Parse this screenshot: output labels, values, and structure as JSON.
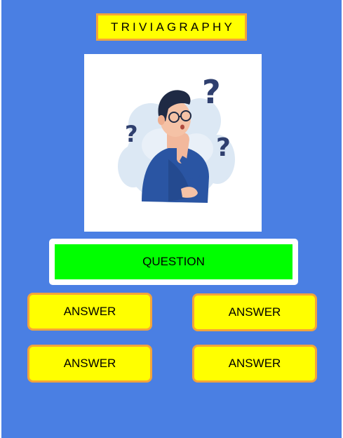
{
  "app": {
    "title": "TRIVIAGRAPHY"
  },
  "illustration": {
    "subject": "thinking-person-with-question-marks"
  },
  "question": {
    "text": "QUESTION"
  },
  "answers": [
    {
      "label": "ANSWER"
    },
    {
      "label": "ANSWER"
    },
    {
      "label": "ANSWER"
    },
    {
      "label": "ANSWER"
    }
  ],
  "colors": {
    "background": "#4a7fe3",
    "title_fill": "#ffff00",
    "button_border": "#f4a33a",
    "question_fill": "#00ff00",
    "answer_fill": "#ffff00"
  }
}
